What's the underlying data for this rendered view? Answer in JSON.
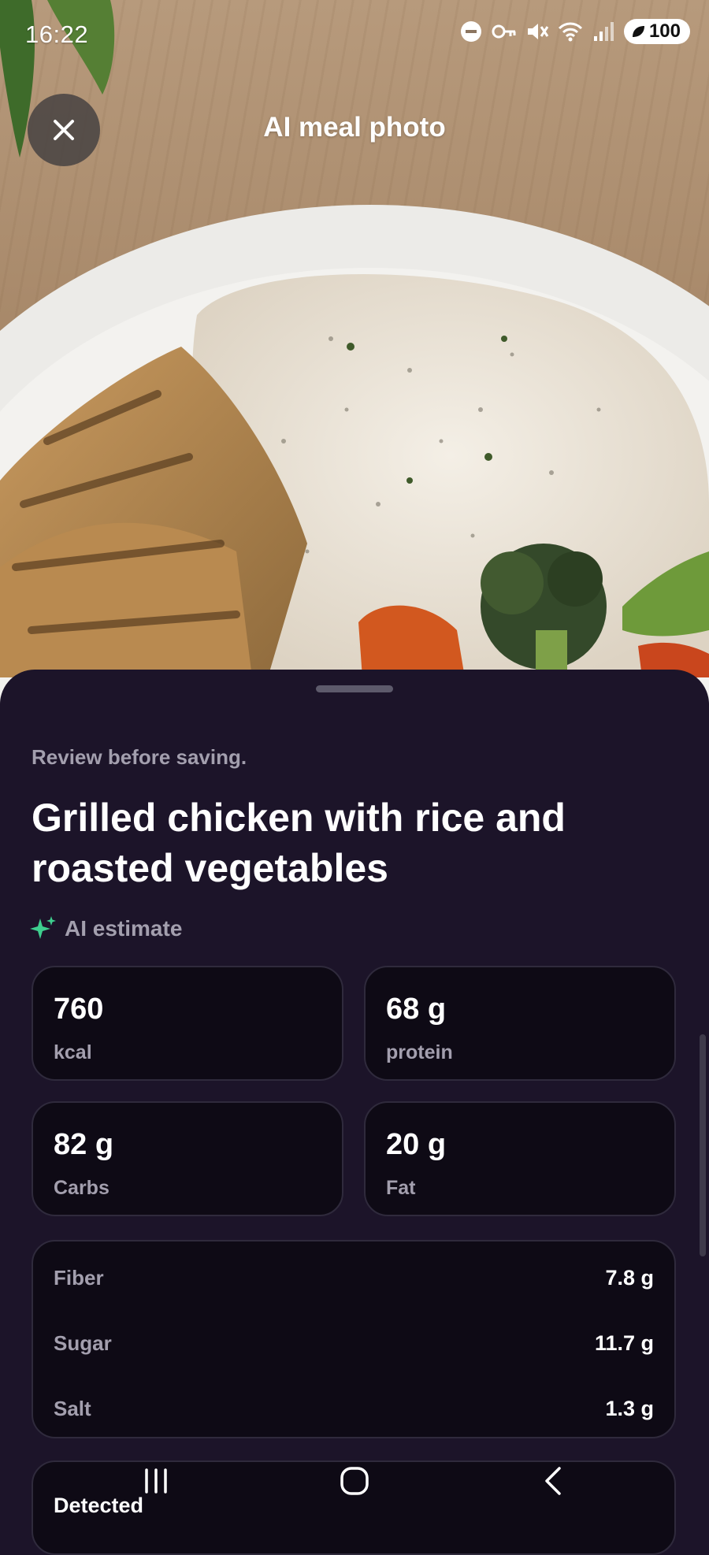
{
  "status_bar": {
    "time": "16:22",
    "battery": "100"
  },
  "header": {
    "title": "AI meal photo"
  },
  "sheet": {
    "subtitle": "Review before saving.",
    "meal_name": "Grilled chicken with rice and roasted vegetables",
    "ai_label": "AI estimate",
    "macros": [
      {
        "value": "760",
        "unit": "kcal"
      },
      {
        "value": "68 g",
        "unit": "protein"
      },
      {
        "value": "82 g",
        "unit": "Carbs"
      },
      {
        "value": "20 g",
        "unit": "Fat"
      }
    ],
    "nutrients": [
      {
        "label": "Fiber",
        "value": "7.8 g"
      },
      {
        "label": "Sugar",
        "value": "11.7 g"
      },
      {
        "label": "Salt",
        "value": "1.3 g"
      }
    ],
    "detected_label": "Detected"
  },
  "icons": {
    "close": "close-icon",
    "ai": "sparkle-icon",
    "nav": [
      "recent-apps-icon",
      "home-icon",
      "back-icon"
    ]
  },
  "colors": {
    "sheet_background": "#1c1429",
    "card_background": "#0e0a15",
    "accent_green": "#3ecf8e",
    "muted_text": "#a39fae"
  }
}
